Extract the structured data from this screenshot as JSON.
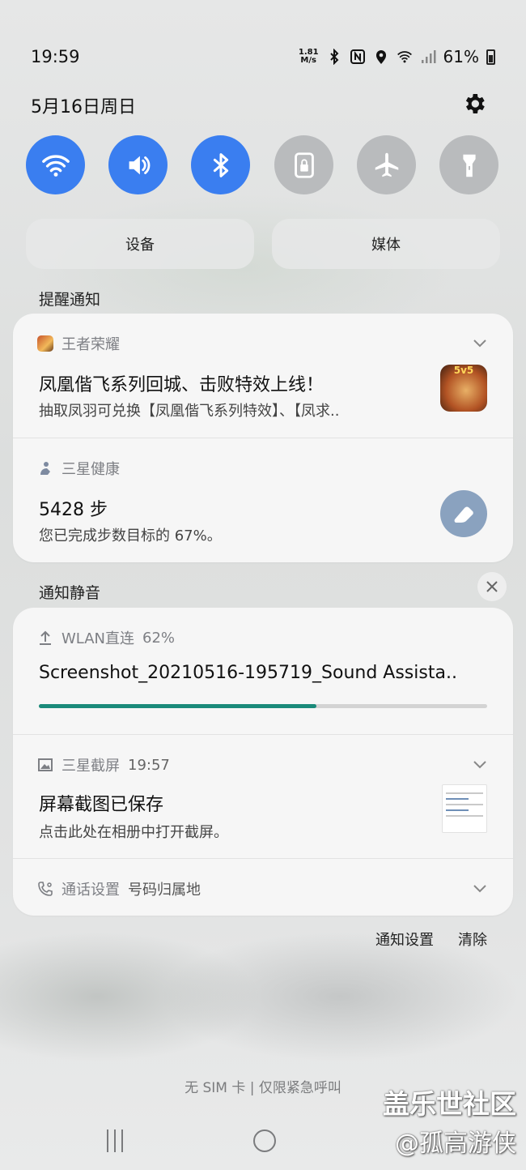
{
  "status_bar": {
    "time": "19:59",
    "net_speed_value": "1.81",
    "net_speed_unit": "M/s",
    "battery": "61%"
  },
  "header": {
    "date": "5月16日周日"
  },
  "quick_toggles": [
    {
      "name": "wifi",
      "state": "on"
    },
    {
      "name": "sound",
      "state": "on"
    },
    {
      "name": "bluetooth",
      "state": "on"
    },
    {
      "name": "rotation-lock",
      "state": "off"
    },
    {
      "name": "airplane-mode",
      "state": "off"
    },
    {
      "name": "flashlight",
      "state": "off"
    }
  ],
  "pills": {
    "devices": "设备",
    "media": "媒体"
  },
  "alerting": {
    "label": "提醒通知",
    "game": {
      "app_name": "王者荣耀",
      "title": "凤凰偕飞系列回城、击败特效上线！",
      "body": "抽取凤羽可兑换【凤凰偕飞系列特效】、【凤求..",
      "icon_badge": "5v5"
    },
    "health": {
      "app_name": "三星健康",
      "title": "5428 步",
      "body": "您已完成步数目标的 67%。"
    }
  },
  "silent": {
    "label": "通知静音",
    "transfer": {
      "app_name": "WLAN直连",
      "percent_label": "62%",
      "progress": 0.62,
      "file_name": "Screenshot_20210516-195719_Sound Assista.."
    },
    "screenshot": {
      "app_name": "三星截屏",
      "time": "19:57",
      "title": "屏幕截图已保存",
      "body": "点击此处在相册中打开截屏。"
    },
    "call": {
      "app_name": "通话设置",
      "subtext": "号码归属地"
    }
  },
  "footer": {
    "notification_settings": "通知设置",
    "clear": "清除",
    "sim_status": "无 SIM 卡 | 仅限紧急呼叫"
  },
  "watermark": {
    "line1": "盖乐世社区",
    "line2": "@孤高游侠"
  },
  "colors": {
    "toggle_on": "#3a7ef0",
    "toggle_off": "#b9bbbd",
    "progress": "#1a8a7a"
  }
}
